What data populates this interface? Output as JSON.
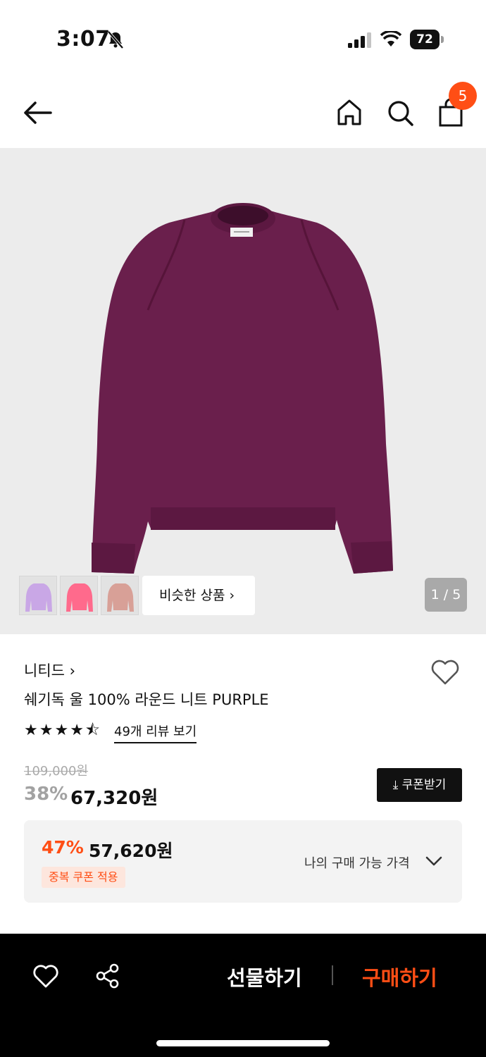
{
  "status": {
    "time": "3:07",
    "battery": "72",
    "icons": [
      "bell-slash-icon",
      "signal-icon",
      "wifi-icon",
      "battery-icon"
    ]
  },
  "header": {
    "cart_count": "5",
    "icons": [
      "back-arrow-icon",
      "home-icon",
      "search-icon",
      "shopping-bag-icon"
    ]
  },
  "gallery": {
    "similar_label": "비슷한 상품 ›",
    "counter": "1 / 5",
    "image_index": 1,
    "image_total": 5,
    "thumbnails": [
      {
        "color": "#c9a7e6"
      },
      {
        "color": "#ff6a8c"
      },
      {
        "color": "#d8a097"
      }
    ],
    "main_color": "#6a1f4c",
    "background": "#ececec"
  },
  "product": {
    "brand": "니티드 ›",
    "title": "쉐기독 울 100% 라운드 니트 PURPLE",
    "rating": 4.5,
    "rating_max": 5,
    "reviews_label": "49개 리뷰 보기",
    "original_price": "109,000원",
    "discount_rate": "38%",
    "price": "67,320원",
    "coupon_button": "⤓ 쿠폰받기"
  },
  "my_price": {
    "rate": "47%",
    "price": "57,620원",
    "tag": "중복 쿠폰 적용",
    "label": "나의 구매 가능 가격"
  },
  "bottom_bar": {
    "gift_label": "선물하기",
    "buy_label": "구매하기",
    "accent": "#ff4e15"
  }
}
